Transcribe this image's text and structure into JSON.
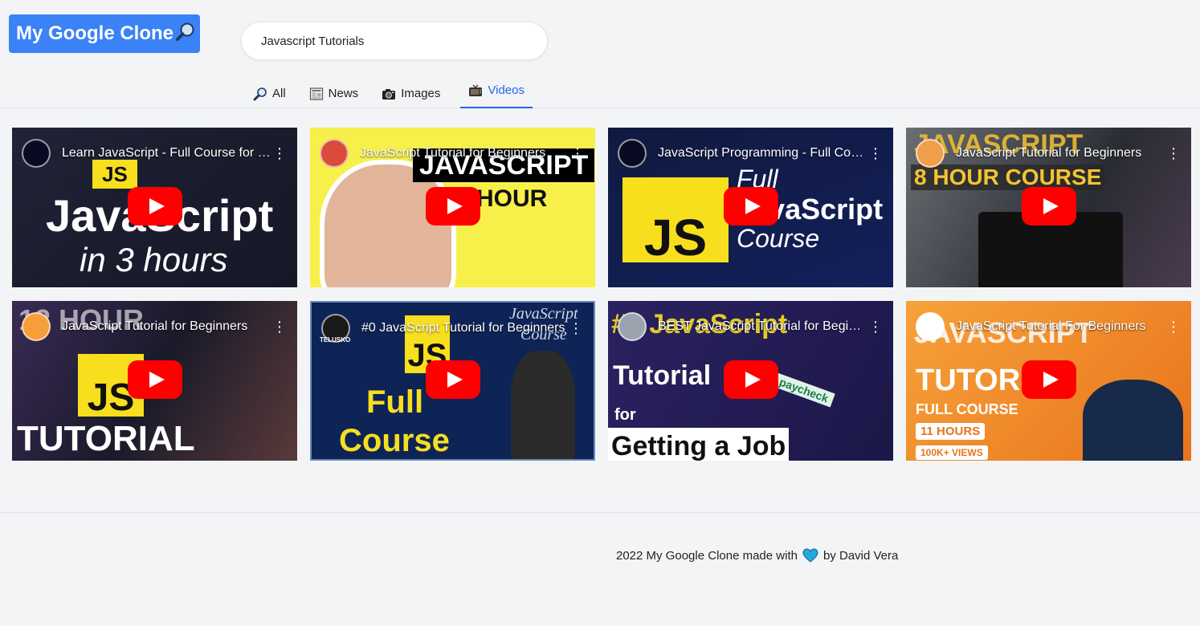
{
  "logo": {
    "text": "My Google Clone"
  },
  "search": {
    "value": "Javascript Tutorials"
  },
  "tabs": [
    {
      "label": "All",
      "icon": "magnifier-icon"
    },
    {
      "label": "News",
      "icon": "newspaper-icon"
    },
    {
      "label": "Images",
      "icon": "camera-icon"
    },
    {
      "label": "Videos",
      "icon": "tv-icon",
      "active": true
    }
  ],
  "videos": [
    {
      "title": "Learn JavaScript - Full Course for Beginners",
      "overlay": [
        "JavaScript",
        "in 3 hours"
      ],
      "badge": "JS"
    },
    {
      "title": "JavaScript Tutorial for Beginners",
      "overlay": [
        "JAVASCRIPT",
        "1 HOUR"
      ]
    },
    {
      "title": "JavaScript Programming - Full Course",
      "overlay": [
        "JS",
        "Full",
        "JavaScript",
        "Course"
      ]
    },
    {
      "title": "JavaScript Tutorial for Beginners",
      "overlay": [
        "JAVASCRIPT",
        "8 HOUR COURSE"
      ]
    },
    {
      "title": "JavaScript Tutorial for Beginners",
      "overlay": [
        "12 HOUR",
        "JS",
        "TUTORIAL"
      ]
    },
    {
      "title": "#0 JavaScript Tutorial for Beginners",
      "overlay": [
        "JavaScript",
        "Course",
        "JS",
        "Full",
        "Course"
      ],
      "badge": "TELUSKO"
    },
    {
      "title": "BEST JavaScript Tutorial for Beginners",
      "overlay": [
        "#1 JavaScript",
        "Tutorial",
        "for",
        "Getting a Job",
        "paycheck"
      ]
    },
    {
      "title": "JavaScript Tutorial For Beginners",
      "overlay": [
        "JAVASCRIPT",
        "TUTORIAL",
        "FULL COURSE",
        "11 HOURS",
        "100K+ VIEWS"
      ]
    }
  ],
  "footer": {
    "prefix": "2022 My Google Clone made with",
    "suffix": "by David Vera"
  },
  "colors": {
    "accent": "#2563eb",
    "logo_bg": "#3b82f6",
    "play_red": "#ff0000",
    "heart": "#29a8e0"
  }
}
